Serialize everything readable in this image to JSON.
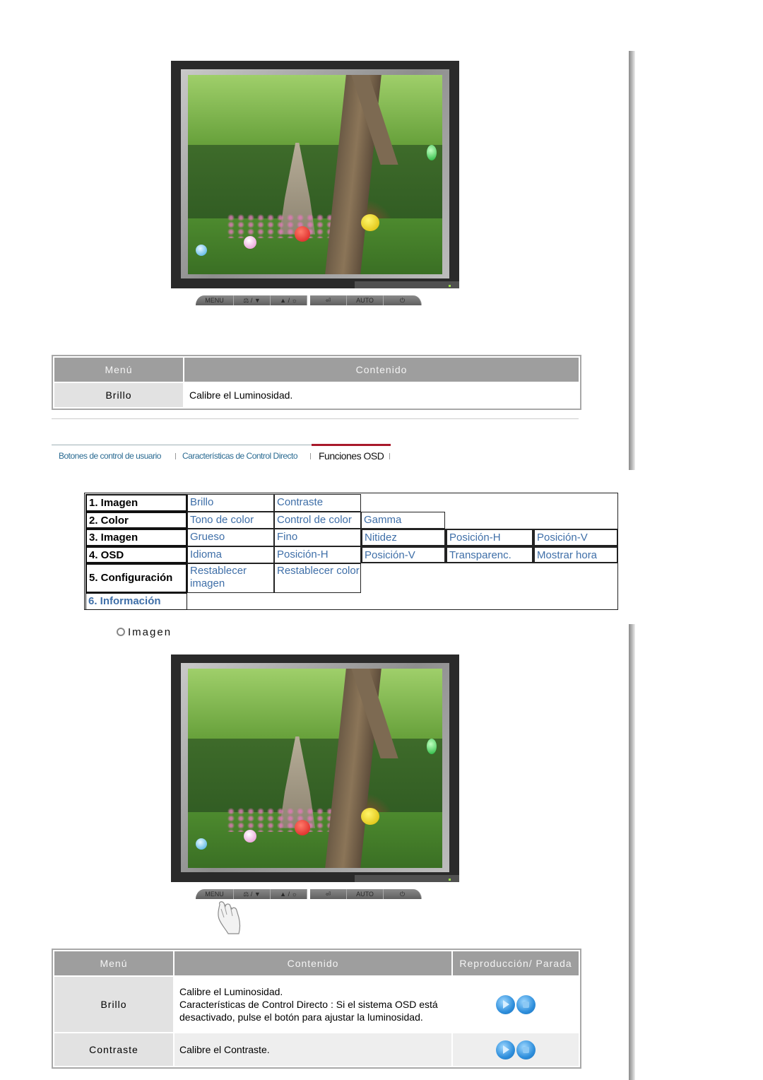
{
  "monitor_buttons": [
    "MENU",
    "⚖ / ▼",
    "▲ / ☼",
    "⏎",
    "AUTO",
    "⏻"
  ],
  "table1": {
    "headers": [
      "Menú",
      "Contenido"
    ],
    "rows": [
      {
        "menu": "Brillo",
        "content": "Calibre el Luminosidad."
      }
    ]
  },
  "tabs": [
    {
      "label": "Botones de control de usuario",
      "active": false
    },
    {
      "label": "Características de Control Directo",
      "active": false
    },
    {
      "label": "Funciones OSD",
      "active": true
    }
  ],
  "osd_menu": {
    "rows": [
      {
        "header": "1. Imagen",
        "items": [
          "Brillo",
          "Contraste"
        ]
      },
      {
        "header": "2. Color",
        "items": [
          "Tono de color",
          "Control de color",
          "Gamma"
        ]
      },
      {
        "header": "3. Imagen",
        "items": [
          "Grueso",
          "Fino",
          "Nitidez",
          "Posición-H",
          "Posición-V"
        ]
      },
      {
        "header": "4. OSD",
        "items": [
          "Idioma",
          "Posición-H",
          "Posición-V",
          "Transparenc.",
          "Mostrar hora"
        ]
      },
      {
        "header": "5. Configuración",
        "items": [
          "Restablecer imagen",
          "Restablecer color"
        ]
      },
      {
        "header": "6. Información",
        "items": []
      }
    ]
  },
  "section": {
    "title": "Imagen",
    "icon": "circle-arrow-icon"
  },
  "table2": {
    "headers": [
      "Menú",
      "Contenido",
      "Reproducción/ Parada"
    ],
    "rows": [
      {
        "menu": "Brillo",
        "content": [
          "Calibre el Luminosidad.",
          "Características de Control Directo : Si el sistema OSD está desactivado, pulse el botón para ajustar la luminosidad."
        ],
        "buttons": [
          "play-icon",
          "stop-icon"
        ]
      },
      {
        "menu": "Contraste",
        "content": [
          "Calibre el Contraste."
        ],
        "buttons": [
          "play-icon",
          "stop-icon"
        ]
      }
    ]
  },
  "colors": {
    "link": "#3f6fa8",
    "tab_active_line": "#a8192b",
    "table_header": "#9e9e9e",
    "menu_cell": "#e2e2e2"
  }
}
